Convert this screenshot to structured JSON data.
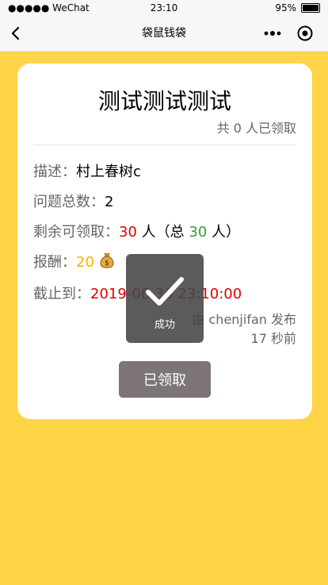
{
  "status_bar": {
    "carrier": "●●●●● WeChat",
    "time": "23:10",
    "battery": "95%"
  },
  "navbar": {
    "title": "袋鼠钱袋"
  },
  "task": {
    "title": "测试测试测试",
    "claimed_text": "共 0 人已领取",
    "description_label": "描述：",
    "description_value": "村上春树c",
    "question_count_label": "问题总数：",
    "question_count_value": "2",
    "remaining_label": "剩余可领取：",
    "remaining_value": "30",
    "remaining_unit": "人（总",
    "total_value": "30",
    "total_unit": "人）",
    "reward_label": "报酬：",
    "reward_value": "20",
    "deadline_label": "截止到：",
    "deadline_value": "2019-06-30 23:10:00",
    "publisher_text": "由 chenjifan 发布",
    "time_ago": "17 秒前",
    "claimed_button_label": "已领取"
  },
  "toast": {
    "text": "成功"
  },
  "colors": {
    "background": "#ffd447",
    "red": "#e00000",
    "green": "#2ea12e",
    "gold": "#f3b600",
    "button_disabled": "#7d7475"
  }
}
